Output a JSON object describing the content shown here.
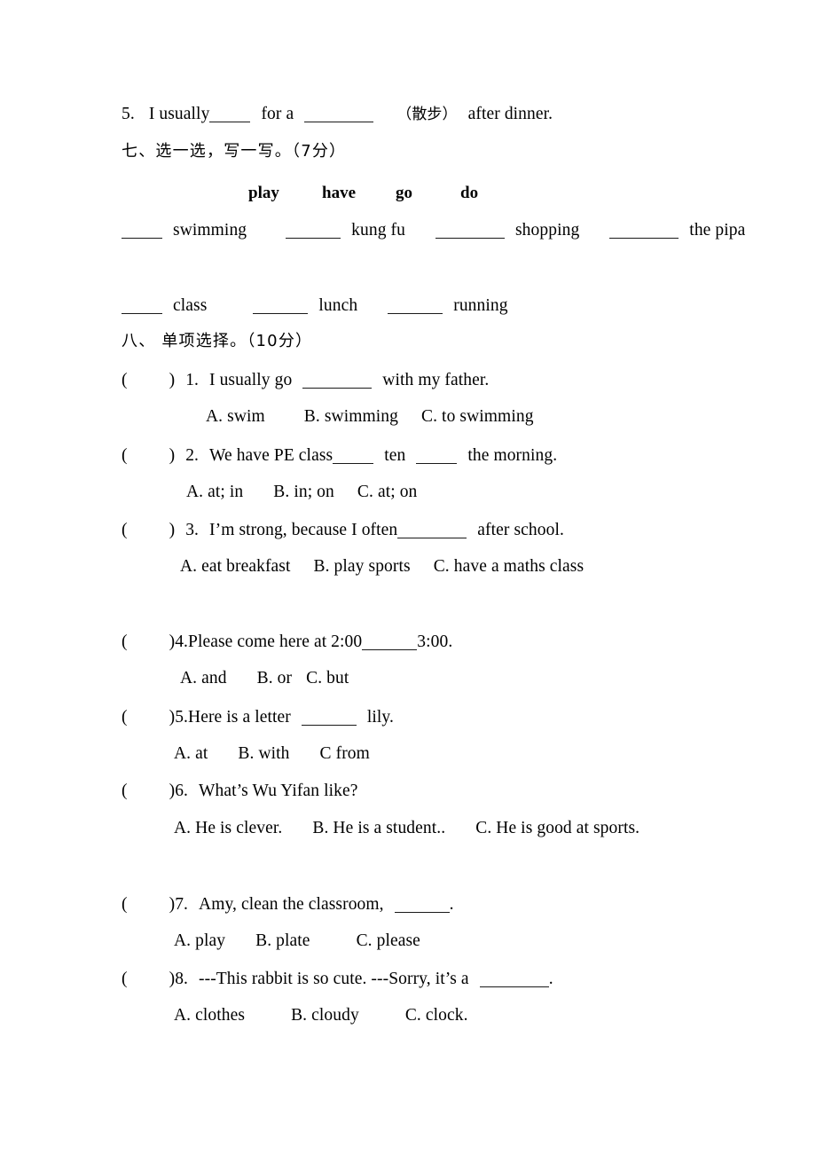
{
  "document": {
    "type": "english-exam-worksheet",
    "language_mix": "English with Chinese instructions",
    "background_color": "#ffffff",
    "text_color": "#000000"
  },
  "fill_in_tail": {
    "number": "5.",
    "before_blank1": "I usually",
    "between": "for a",
    "chinese_hint": "（散步）",
    "after": "after dinner."
  },
  "section_seven": {
    "heading": "七、选一选，写一写。（7分）",
    "word_bank": [
      "play",
      "have",
      "go",
      "do"
    ],
    "items_row1": [
      "swimming",
      "kung fu",
      "shopping",
      "the pipa"
    ],
    "items_row2": [
      "class",
      "lunch",
      "running"
    ]
  },
  "section_eight": {
    "heading": "八、 单项选择。（10分）",
    "questions": [
      {
        "number": "1.",
        "stem_before": "I usually go",
        "stem_after": "with my father.",
        "options": [
          "A. swim",
          "B. swimming",
          "C. to swimming"
        ]
      },
      {
        "number": "2.",
        "stem_before": "We have PE class",
        "stem_mid": "ten",
        "stem_after": "the morning.",
        "options": [
          "A. at; in",
          "B. in; on",
          "C. at; on"
        ]
      },
      {
        "number": "3.",
        "stem_before": "I’m strong, because I often",
        "stem_after": "after school.",
        "options": [
          "A. eat breakfast",
          "B. play sports",
          "C. have a maths class"
        ]
      },
      {
        "number": "4.",
        "stem_before": "Please come here at 2:00",
        "stem_after": "3:00.",
        "options": [
          "A. and",
          "B. or",
          "C. but"
        ]
      },
      {
        "number": "5.",
        "stem_before": "Here is a letter",
        "stem_after": "lily.",
        "options": [
          "A. at",
          "B. with",
          "C from"
        ]
      },
      {
        "number": "6.",
        "stem_full": "What’s Wu Yifan like?",
        "options": [
          "A. He is clever.",
          "B. He is a student..",
          "C. He is good at sports."
        ]
      },
      {
        "number": "7.",
        "stem_before": "Amy, clean the classroom,",
        "stem_after": ".",
        "options": [
          "A. play",
          "B. plate",
          "C. please"
        ]
      },
      {
        "number": "8.",
        "stem_before": "---This rabbit is so cute. ---Sorry, it’s a",
        "stem_after": ".",
        "options": [
          "A. clothes",
          "B. cloudy",
          "C. clock."
        ]
      }
    ]
  }
}
